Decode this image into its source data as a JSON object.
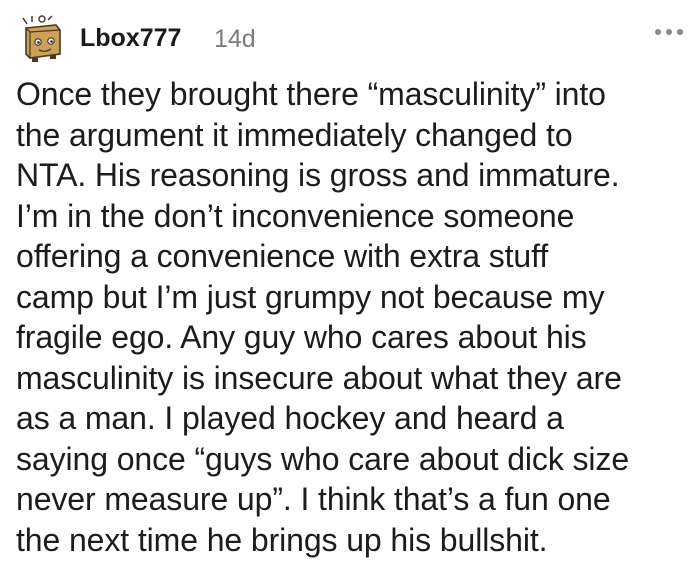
{
  "comment": {
    "author": "Lbox777",
    "age": "14d",
    "more_icon": "more-horizontal-icon",
    "avatar_icon": "snoo-avatar-icon",
    "body_lines": [
      "Once they brought there “masculinity” into",
      "the argument it immediately changed to",
      "NTA. His reasoning is gross and immature.",
      "I’m in the don’t inconvenience someone",
      "offering a convenience with extra stuff",
      "camp but I’m just grumpy not because my",
      "fragile ego. Any guy who cares about his",
      "masculinity is insecure about what they are",
      "as a man. I played hockey and heard a",
      "saying once “guys who care about dick size",
      "never measure up”. I think that’s a fun one",
      "the next time he brings up his bullshit."
    ]
  },
  "colors": {
    "text": "#1c1c1c",
    "meta": "#7c7c7c",
    "avatar_box": "#c9a15a",
    "avatar_outline": "#4a3a1e",
    "background": "#ffffff"
  }
}
